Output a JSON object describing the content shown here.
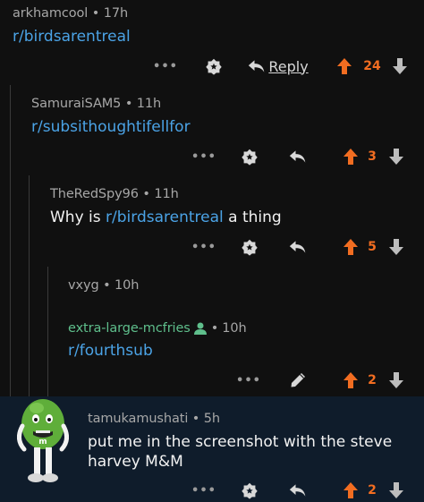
{
  "colors": {
    "background": "#101010",
    "highlight": "#0f1c2b",
    "upvote": "#f26d21",
    "link": "#4ba3e6",
    "username_mod": "#5fbf8c",
    "meta": "#a7a7a7"
  },
  "comments": [
    {
      "author": "arkhamcool",
      "sep": "•",
      "time": "17h",
      "link": "r/birdsarentreal",
      "more": "•••",
      "reply_label": "Reply",
      "score": "24",
      "icons": [
        "more-icon",
        "award-icon",
        "reply-icon",
        "upvote-icon",
        "downvote-icon"
      ]
    },
    {
      "author": "SamuraiSAM5",
      "sep": "•",
      "time": "11h",
      "link": "r/subsithoughtifellfor",
      "more": "•••",
      "score": "3"
    },
    {
      "author": "TheRedSpy96",
      "sep": "•",
      "time": "11h",
      "text_before": "Why is ",
      "link": "r/birdsarentreal",
      "text_after": " a thing",
      "more": "•••",
      "score": "5"
    },
    {
      "author": "vxyg",
      "sep": "•",
      "time": "10h"
    },
    {
      "author": "extra-large-mcfries",
      "author_badge": "user-icon",
      "sep": "•",
      "time": "10h",
      "link": "r/fourthsub",
      "more": "•••",
      "score": "2",
      "edit_icon": "pencil-icon"
    },
    {
      "author": "tamukamushati",
      "sep": "•",
      "time": "5h",
      "text_line1": "put me in the screenshot with the steve",
      "text_line2": "harvey M&M",
      "more": "•••",
      "score": "2",
      "avatar": "green-mm-character-avatar"
    }
  ]
}
